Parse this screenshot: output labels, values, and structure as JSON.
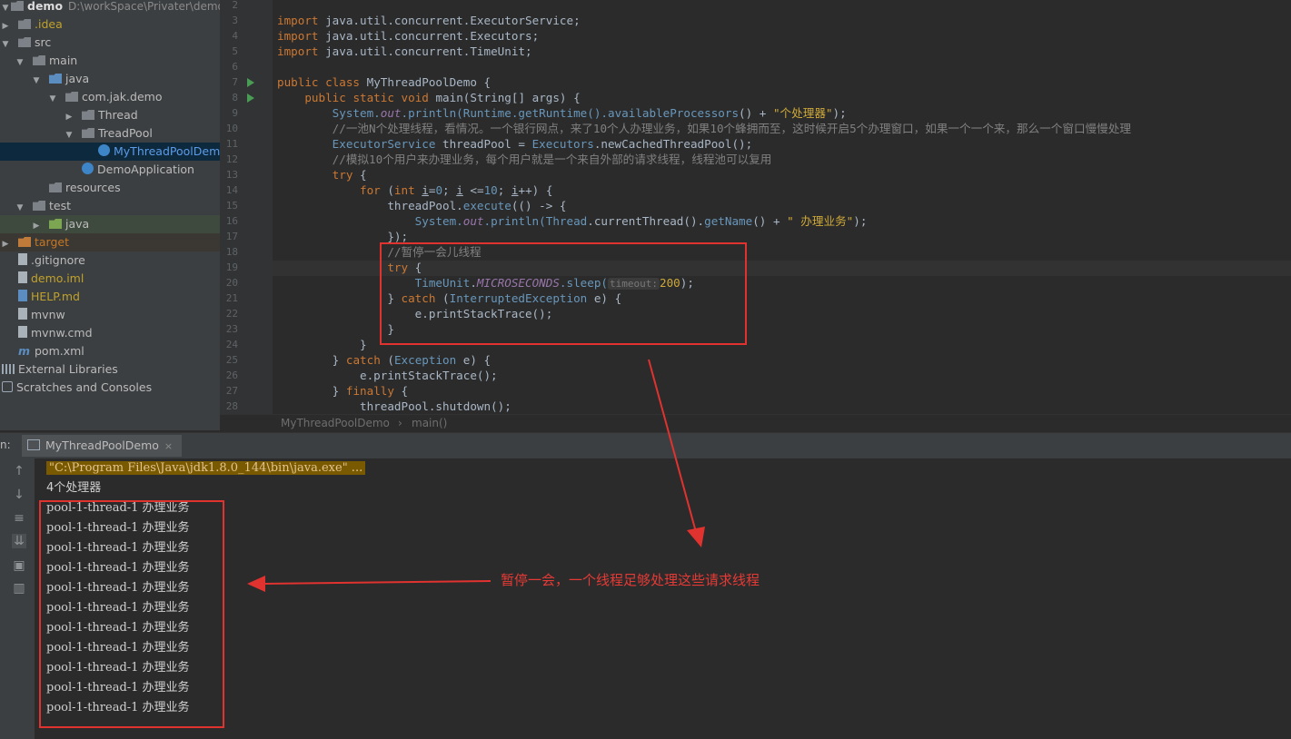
{
  "project": {
    "root_name": "demo",
    "root_path": "D:\\workSpace\\Privater\\demo",
    "items": [
      {
        "label": "demo"
      },
      {
        "label": ".idea"
      },
      {
        "label": "src"
      },
      {
        "label": "main"
      },
      {
        "label": "java"
      },
      {
        "label": "com.jak.demo"
      },
      {
        "label": "Thread"
      },
      {
        "label": "TreadPool"
      },
      {
        "label": "MyThreadPoolDemo"
      },
      {
        "label": "DemoApplication"
      },
      {
        "label": "resources"
      },
      {
        "label": "test"
      },
      {
        "label": "java"
      },
      {
        "label": "target"
      },
      {
        "label": ".gitignore"
      },
      {
        "label": "demo.iml"
      },
      {
        "label": "HELP.md"
      },
      {
        "label": "mvnw"
      },
      {
        "label": "mvnw.cmd"
      },
      {
        "label": "pom.xml"
      },
      {
        "label": "External Libraries"
      },
      {
        "label": "Scratches and Consoles"
      }
    ]
  },
  "editor": {
    "line_numbers": [
      "2",
      "3",
      "4",
      "5",
      "6",
      "7",
      "8",
      "9",
      "10",
      "11",
      "12",
      "13",
      "14",
      "15",
      "16",
      "17",
      "18",
      "19",
      "20",
      "21",
      "22",
      "23",
      "24",
      "25",
      "26",
      "27",
      "28"
    ],
    "tokens": {
      "import": "import",
      "pkg_concurrent": "java.util.concurrent.",
      "ExecutorService": "ExecutorService",
      "Executors": "Executors",
      "TimeUnit": "TimeUnit",
      "semi": ";",
      "public": "public",
      "class": "class",
      "static": "static",
      "void": "void",
      "class_name": "MyThreadPoolDemo",
      "main_sig": " main(String[] args) {",
      "system": "System.",
      "out": "out",
      "println_open": ".println(",
      "runtime": "Runtime",
      "getRuntime": ".getRuntime().",
      "availableProcessors": "availableProcessors",
      "plus": "() + ",
      "str_processors": "\"个处理器\"",
      "close_semi": ");",
      "comment1": "//一池N个处理线程，看情况。一个银行网点，来了10个人办理业务，如果10个蜂拥而至，这时候开启5个办理窗口，如果一个一个来，那么一个窗口慢慢处理",
      "thread_pool_decl": " threadPool = ",
      "executors_call": ".newCachedThreadPool();",
      "comment2": "//模拟10个用户来办理业务，每个用户就是一个来自外部的请求线程，线程池可以复用",
      "try": "try",
      "brace_open": " {",
      "for": "for",
      "int": "int",
      "for_i": "i",
      "for_eq": "=",
      "zero": "0",
      "for_cond": " <=",
      "ten": "10",
      "for_inc": "++) {",
      "threadPool": "threadPool.",
      "execute": "execute",
      "lambda": "(() -> {",
      "thread": "Thread",
      "currentThread": ".currentThread().",
      "getName": "getName",
      "plus2": "() + ",
      "str_business": "\" 办理业务\"",
      "lambda_close": "});",
      "comment3": "//暂停一会儿线程",
      "microseconds": "MICROSECONDS",
      "sleep": ".sleep(",
      "hint_timeout": "timeout:",
      "two_hundred": "200",
      "catch": "catch",
      "interrupted": "InterruptedException",
      "e_param": " e) {",
      "print_stack": "e.printStackTrace();",
      "close_brace": "}",
      "exception": "Exception",
      "finally": "finally",
      "shutdown": "threadPool.shutdown();",
      "space": " ",
      "lparen": " (",
      "for_open": " (",
      "semi_sp": "; "
    }
  },
  "breadcrumb": {
    "file": "MyThreadPoolDemo",
    "sep": "›",
    "method": "main()"
  },
  "run": {
    "label": "n:",
    "tab_label": "MyThreadPoolDemo",
    "tab_close": "×",
    "command": "\"C:\\Program Files\\Java\\jdk1.8.0_144\\bin\\java.exe\" ...",
    "processors_line": "4个处理器",
    "output_lines": [
      "pool-1-thread-1 办理业务",
      "pool-1-thread-1 办理业务",
      "pool-1-thread-1 办理业务",
      "pool-1-thread-1 办理业务",
      "pool-1-thread-1 办理业务",
      "pool-1-thread-1 办理业务",
      "pool-1-thread-1 办理业务",
      "pool-1-thread-1 办理业务",
      "pool-1-thread-1 办理业务",
      "pool-1-thread-1 办理业务",
      "pool-1-thread-1 办理业务"
    ]
  },
  "annotation": {
    "text": "暂停一会，一个线程足够处理这些请求线程",
    "color": "#e0322f"
  },
  "icons": [
    "folder-icon",
    "class-icon",
    "file-icon",
    "library-icon",
    "run-arrow-icon",
    "console-icon",
    "close-icon",
    "up-arrow-icon",
    "down-arrow-icon",
    "soft-wrap-icon",
    "scroll-to-end-icon",
    "print-icon",
    "trash-icon"
  ]
}
